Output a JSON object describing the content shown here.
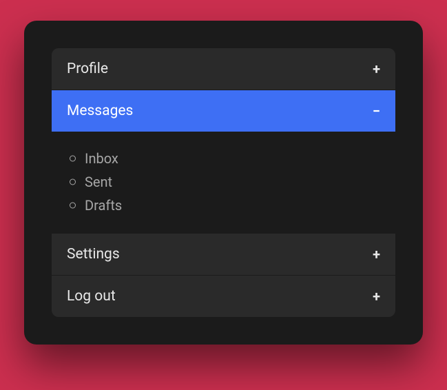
{
  "menu": {
    "items": [
      {
        "label": "Profile",
        "expanded": false
      },
      {
        "label": "Messages",
        "expanded": true,
        "children": [
          "Inbox",
          "Sent",
          "Drafts"
        ]
      },
      {
        "label": "Settings",
        "expanded": false
      },
      {
        "label": "Log out",
        "expanded": false
      }
    ]
  },
  "icons": {
    "plus": "+",
    "minus": "−"
  }
}
